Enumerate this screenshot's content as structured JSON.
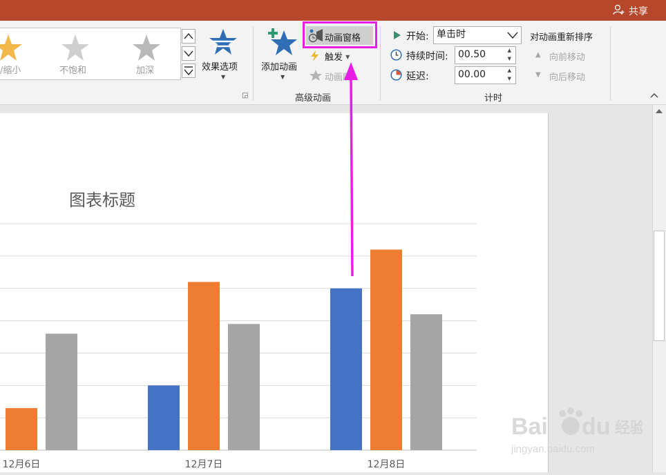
{
  "titlebar": {
    "share_label": "共享"
  },
  "ribbon": {
    "gallery": {
      "items": [
        "放大/缩小",
        "不饱和",
        "加深"
      ],
      "partial_label": "/缩小"
    },
    "effect_options_label": "效果选项",
    "add_animation_label": "添加动画",
    "animation_pane_label": "动画窗格",
    "trigger_label": "触发",
    "animation_painter_label": "动画刷",
    "advanced_group_label": "高级动画",
    "timing": {
      "start_label": "开始:",
      "start_value": "单击时",
      "duration_label": "持续时间:",
      "duration_value": "00.50",
      "delay_label": "延迟:",
      "delay_value": "00.00",
      "group_label": "计时"
    },
    "reorder": {
      "title": "对动画重新排序",
      "move_earlier": "向前移动",
      "move_later": "向后移动"
    }
  },
  "chart_data": {
    "type": "bar",
    "title": "图表标题",
    "categories": [
      "12月6日",
      "12月7日",
      "12月8日"
    ],
    "series": [
      {
        "values": [
          null,
          2,
          5
        ],
        "color": "#4472c4"
      },
      {
        "values": [
          1.3,
          5.2,
          6.2
        ],
        "color": "#ed7d31"
      },
      {
        "values": [
          3.6,
          3.9,
          4.2
        ],
        "color": "#a5a5a5"
      }
    ],
    "ylim": [
      0,
      7
    ],
    "grid": true
  },
  "watermark": {
    "brand": "Bai du 经验",
    "url": "jingyan.baidu.com"
  },
  "colors": {
    "titlebar": "#b7472a",
    "highlight": "#e81ee6"
  }
}
